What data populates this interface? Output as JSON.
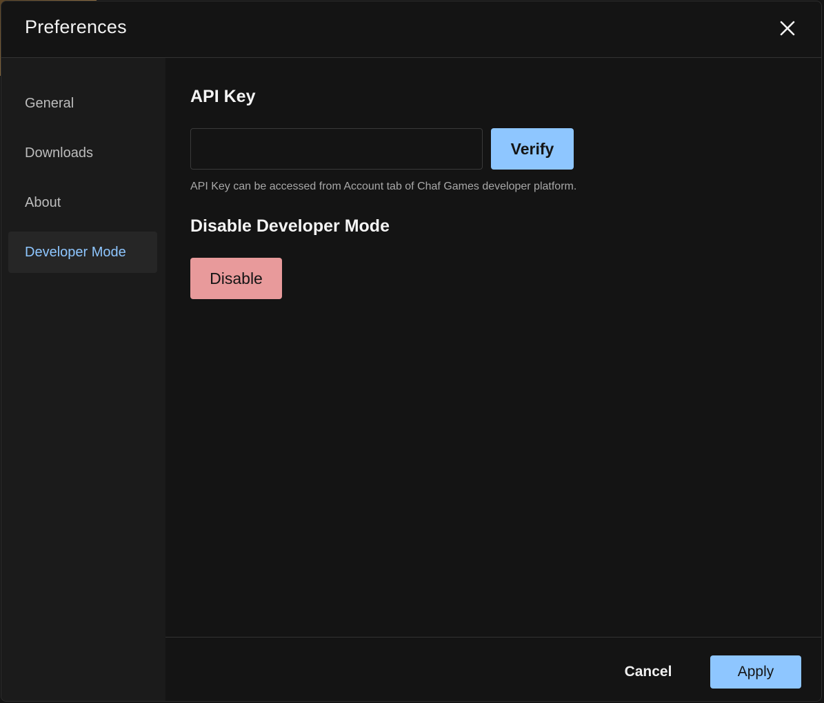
{
  "dialog": {
    "title": "Preferences",
    "close_icon": "close-icon"
  },
  "sidebar": {
    "items": [
      {
        "label": "General",
        "active": false
      },
      {
        "label": "Downloads",
        "active": false
      },
      {
        "label": "About",
        "active": false
      },
      {
        "label": "Developer Mode",
        "active": true
      }
    ]
  },
  "main": {
    "api_key": {
      "heading": "API Key",
      "input_value": "",
      "input_placeholder": "",
      "verify_label": "Verify",
      "hint": "API Key can be accessed from Account tab of Chaf Games developer platform."
    },
    "disable_section": {
      "heading": "Disable Developer Mode",
      "disable_label": "Disable"
    }
  },
  "footer": {
    "cancel_label": "Cancel",
    "apply_label": "Apply"
  },
  "colors": {
    "accent": "#8ec6ff",
    "danger": "#e89a9b",
    "background": "#141414",
    "sidebar_background": "#1b1b1b"
  }
}
